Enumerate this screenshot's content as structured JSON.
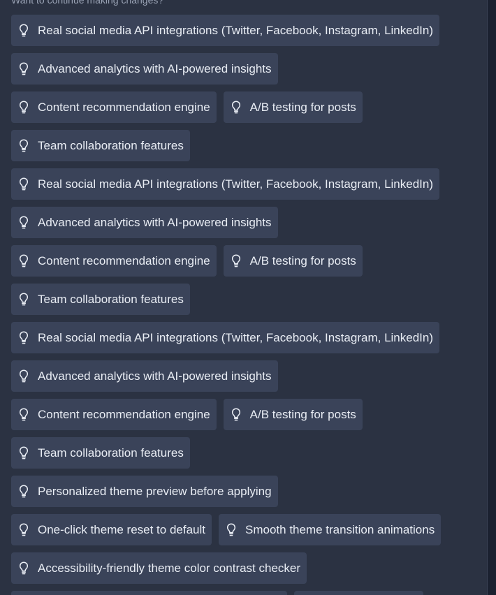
{
  "prompt": "Want to continue making changes?",
  "icon": "lightbulb-icon",
  "rows": [
    [
      "Real social media API integrations (Twitter, Facebook, Instagram, LinkedIn)"
    ],
    [
      "Advanced analytics with AI-powered insights"
    ],
    [
      "Content recommendation engine",
      "A/B testing for posts"
    ],
    [
      "Team collaboration features"
    ],
    [
      "Real social media API integrations (Twitter, Facebook, Instagram, LinkedIn)"
    ],
    [
      "Advanced analytics with AI-powered insights"
    ],
    [
      "Content recommendation engine",
      "A/B testing for posts"
    ],
    [
      "Team collaboration features"
    ],
    [
      "Real social media API integrations (Twitter, Facebook, Instagram, LinkedIn)"
    ],
    [
      "Advanced analytics with AI-powered insights"
    ],
    [
      "Content recommendation engine",
      "A/B testing for posts"
    ],
    [
      "Team collaboration features"
    ],
    [
      "Personalized theme preview before applying"
    ],
    [
      "One-click theme reset to default",
      "Smooth theme transition animations"
    ],
    [
      "Accessibility-friendly theme color contrast checker"
    ]
  ]
}
